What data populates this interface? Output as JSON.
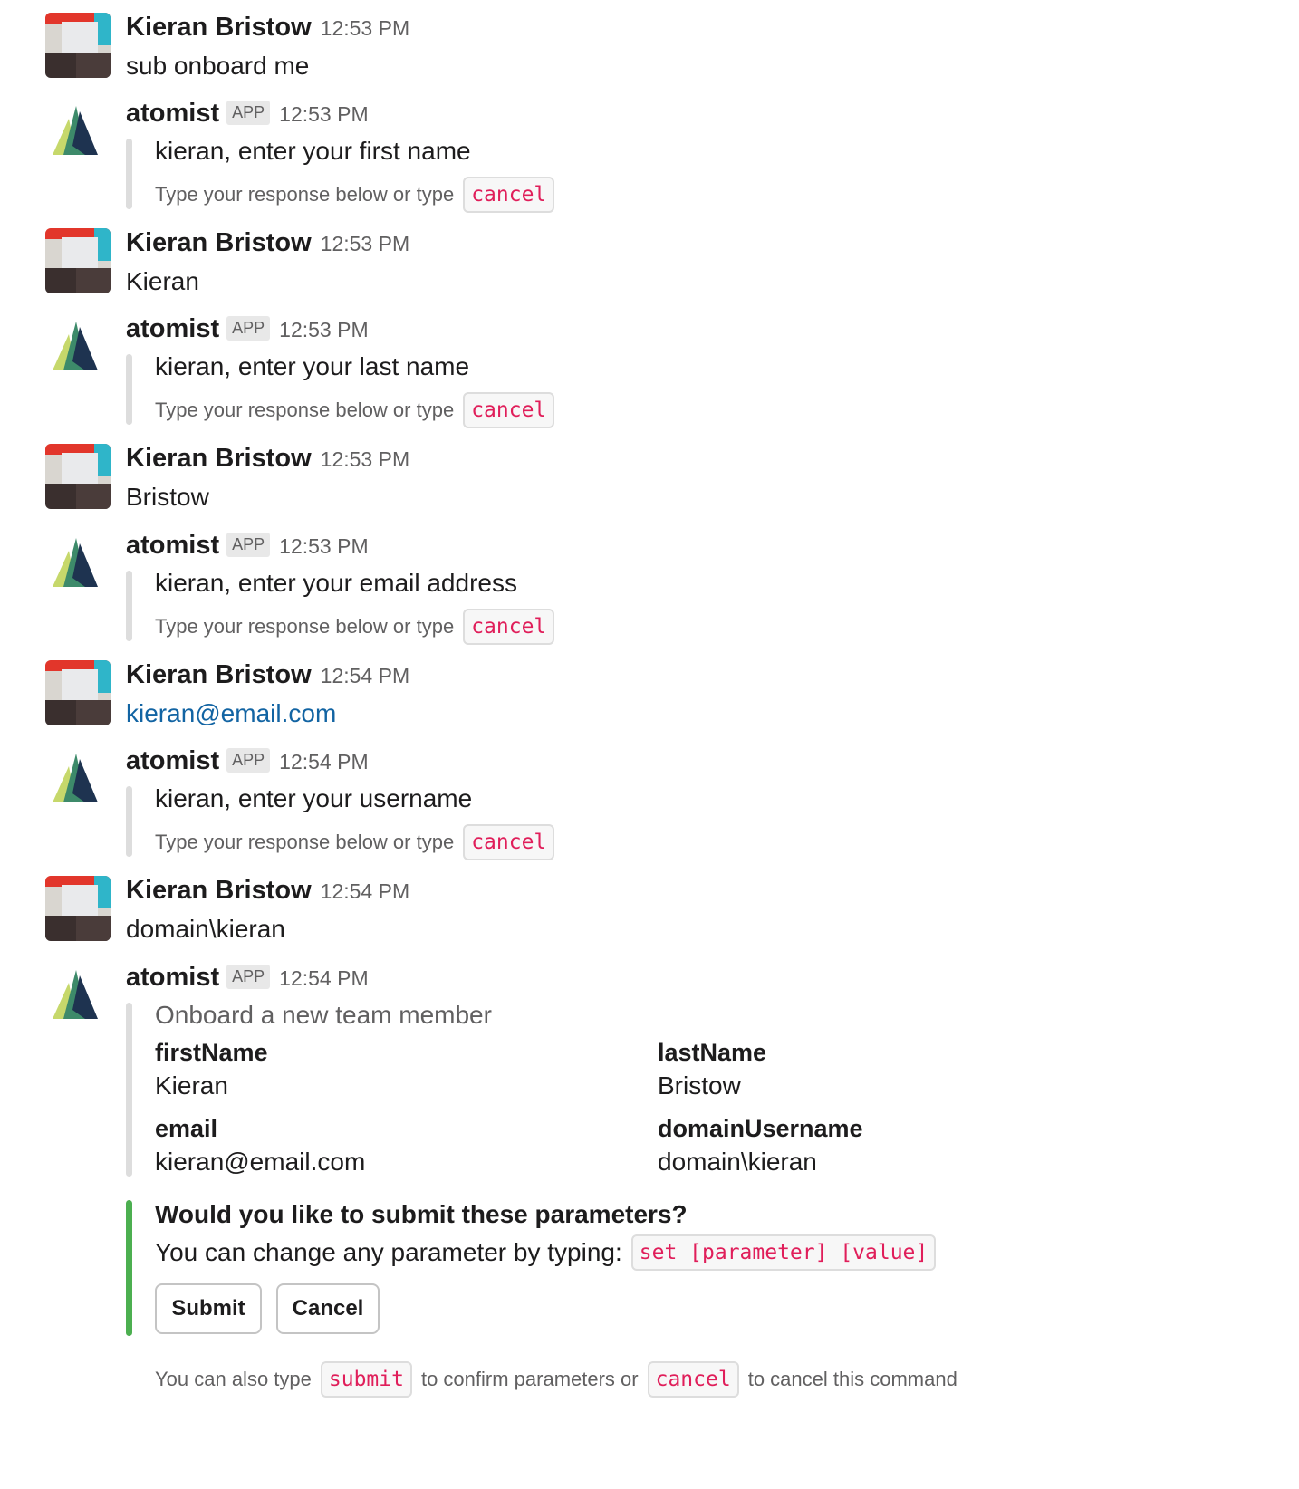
{
  "messages": [
    {
      "sender": "Kieran Bristow",
      "time": "12:53 PM",
      "text": "sub onboard me"
    },
    {
      "sender": "atomist",
      "badge": "APP",
      "time": "12:53 PM",
      "prompt": "kieran, enter your first name",
      "hint": "Type your response below or type",
      "hint_code": "cancel"
    },
    {
      "sender": "Kieran Bristow",
      "time": "12:53 PM",
      "text": "Kieran"
    },
    {
      "sender": "atomist",
      "badge": "APP",
      "time": "12:53 PM",
      "prompt": "kieran, enter your last name",
      "hint": "Type your response below or type",
      "hint_code": "cancel"
    },
    {
      "sender": "Kieran Bristow",
      "time": "12:53 PM",
      "text": "Bristow"
    },
    {
      "sender": "atomist",
      "badge": "APP",
      "time": "12:53 PM",
      "prompt": "kieran, enter your email address",
      "hint": "Type your response below or type",
      "hint_code": "cancel"
    },
    {
      "sender": "Kieran Bristow",
      "time": "12:54 PM",
      "text": "kieran@email.com"
    },
    {
      "sender": "atomist",
      "badge": "APP",
      "time": "12:54 PM",
      "prompt": "kieran, enter your username",
      "hint": "Type your response below or type",
      "hint_code": "cancel"
    },
    {
      "sender": "Kieran Bristow",
      "time": "12:54 PM",
      "text": "domain\\kieran"
    },
    {
      "sender": "atomist",
      "badge": "APP",
      "time": "12:54 PM"
    }
  ],
  "summary": {
    "title": "Onboard a new team member",
    "fields": [
      {
        "label": "firstName",
        "value": "Kieran"
      },
      {
        "label": "lastName",
        "value": "Bristow"
      },
      {
        "label": "email",
        "value": "kieran@email.com"
      },
      {
        "label": "domainUsername",
        "value": "domain\\kieran"
      }
    ]
  },
  "confirm": {
    "question": "Would you like to submit these parameters?",
    "change_text": "You can change any parameter by typing:",
    "change_code": "set [parameter] [value]",
    "submit_label": "Submit",
    "cancel_label": "Cancel",
    "note_pre": "You can also type",
    "note_code1": "submit",
    "note_mid": "to confirm parameters or",
    "note_code2": "cancel",
    "note_post": "to cancel this command"
  },
  "colors": {
    "link": "#1264a3",
    "code": "#e01e5a",
    "green_bar": "#4caf50"
  }
}
